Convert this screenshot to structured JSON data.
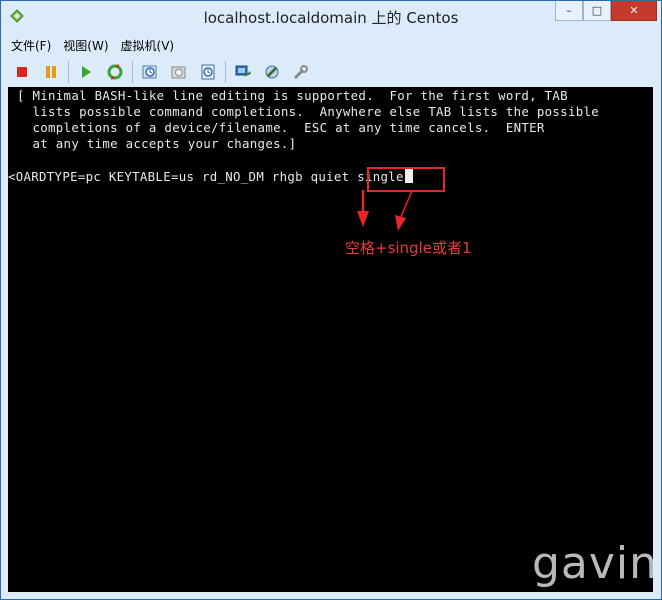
{
  "window": {
    "title": "localhost.localdomain 上的 Centos",
    "buttons": {
      "minimize": "–",
      "maximize": "□",
      "close": "✕"
    }
  },
  "menu": [
    "文件(F)",
    "视图(W)",
    "虚拟机(V)"
  ],
  "toolbar": {
    "icons": [
      "stop-icon",
      "pause-icon",
      "play-icon",
      "reset-icon",
      "snapshot-icon",
      "revert-snapshot-icon",
      "snapshot-manager-icon",
      "console-settings-icon",
      "edit-settings-icon",
      "tools-icon"
    ]
  },
  "console": {
    "lines": [
      "[ Minimal BASH-like line editing is supported.  For the first word, TAB",
      "  lists possible command completions.  Anywhere else TAB lists the possible",
      "  completions of a device/filename.  ESC at any time cancels.  ENTER",
      "  at any time accepts your changes.]"
    ],
    "command": "<OARDTYPE=pc KEYTABLE=us rd_NO_DM rhgb quiet single"
  },
  "annotation": "空格+single或者1",
  "watermark": "gavin",
  "colors": {
    "titlebar": "#dcebf9",
    "console_bg": "#000000",
    "annotation": "#e8262a"
  }
}
